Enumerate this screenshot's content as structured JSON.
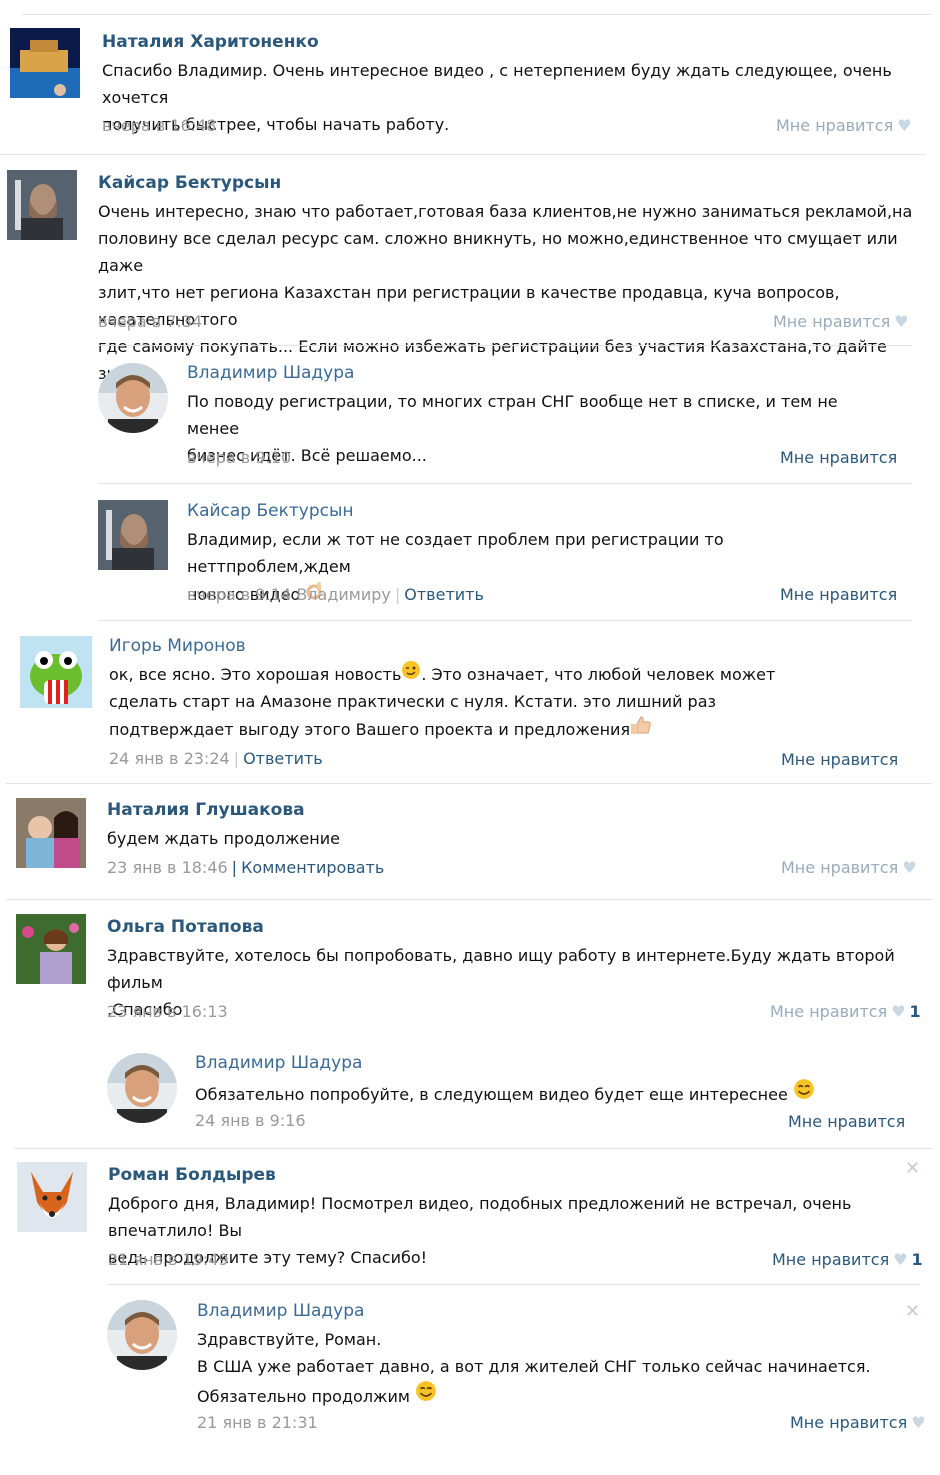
{
  "like_label": "Мне нравится",
  "reply_label": "Ответить",
  "comment_label": "Комментировать",
  "colors": {
    "name": "#2b587a",
    "meta": "#999999",
    "like": "#9aabbb",
    "divider": "#e1e4e8"
  },
  "comments": [
    {
      "name": "Наталия Харитоненко",
      "lines": [
        "Спасибо Владимир. Очень интересное видео , с нетерпением буду ждать следующее, очень хочется",
        "получить быстрее, чтобы начать работу."
      ],
      "time": "вчера в 16:48"
    },
    {
      "name": "Кайсар Бектурсын",
      "lines": [
        "Очень интересно, знаю что работает,готовая база клиентов,не нужно заниматься рекламой,на",
        "половину все сделал ресурс сам. сложно вникнуть, но можно,единственное что смущает или даже",
        "злит,что нет региона Казахстан при регистрации в качестве продавца, куча вопросов, касательно того",
        "где самому покупать... Если можно избежать регистрации без участия Казахстана,то дайте знать"
      ],
      "time": "вчера в 7:34"
    },
    {
      "name": "Владимир Шадура",
      "lines": [
        "По поводу регистрации, то многих стран СНГ вообще нет в списке, и тем не менее",
        "бизнес идёт. Всё решаемо..."
      ],
      "time": "вчера в 9:10"
    },
    {
      "name": "Кайсар Бектурсын",
      "lines": [
        "Владимир, если ж тот не создает проблем при регистрации то неттпроблем,ждем",
        "нового видео"
      ],
      "time": "вчера в 9:14",
      "to": "Владимиру"
    },
    {
      "name": "Игорь Миронов",
      "lines": [
        "ок, все ясно. Это хорошая новость",
        ". Это означает, что любой человек может",
        "сделать старт на Амазоне практически с нуля. Кстати. это лишний раз",
        "подтверждает выгоду этого Вашего проекта и предложения"
      ],
      "time": "24 янв в 23:24"
    },
    {
      "name": "Наталия Глушакова",
      "lines": [
        "будем ждать продолжение"
      ],
      "time": "23 янв в 18:46"
    },
    {
      "name": "Ольга Потапова",
      "lines": [
        "Здравствуйте, хотелось бы попробовать, давно ищу работу в интернете.Буду ждать второй фильм",
        ".Спасибо"
      ],
      "time": "23 янв в 16:13",
      "likes": "1"
    },
    {
      "name": "Владимир Шадура",
      "lines": [
        "Обязательно попробуйте, в следующем видео будет еще интереснее"
      ],
      "time": "24 янв в 9:16"
    },
    {
      "name": "Роман Болдырев",
      "lines": [
        "Доброго дня, Владимир! Посмотрел видео, подобных предложений не встречал, очень впечатлило! Вы",
        "ведь продолжите эту тему? Спасибо!"
      ],
      "time": "21 янв в 19:49",
      "likes": "1"
    },
    {
      "name": "Владимир Шадура",
      "lines": [
        "Здравствуйте, Роман.",
        "В США уже работает давно, а вот для жителей СНГ только сейчас начинается.",
        "Обязательно продолжим"
      ],
      "time": "21 янв в 21:31"
    }
  ]
}
